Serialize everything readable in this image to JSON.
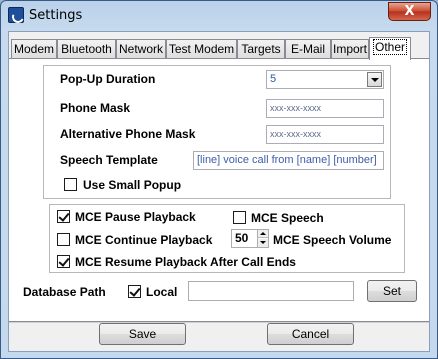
{
  "window": {
    "title": "Settings",
    "close_label": "X"
  },
  "tabs": [
    {
      "label": "Modem"
    },
    {
      "label": "Bluetooth"
    },
    {
      "label": "Network"
    },
    {
      "label": "Test Modem"
    },
    {
      "label": "Targets"
    },
    {
      "label": "E-Mail"
    },
    {
      "label": "Import"
    },
    {
      "label": "Other",
      "active": true
    }
  ],
  "popup": {
    "duration_label": "Pop-Up Duration",
    "duration_value": "5",
    "phone_mask_label": "Phone Mask",
    "phone_mask_value": "xxx-xxx-xxxx",
    "alt_phone_mask_label": "Alternative Phone Mask",
    "alt_phone_mask_value": "xxx-xxx-xxxx",
    "speech_template_label": "Speech Template",
    "speech_template_value": "[line] voice call from [name] [number]",
    "use_small_popup_label": "Use Small Popup",
    "use_small_popup_checked": false
  },
  "mce": {
    "pause_playback_label": "MCE Pause Playback",
    "pause_playback_checked": true,
    "speech_label": "MCE Speech",
    "speech_checked": false,
    "continue_playback_label": "MCE Continue Playback",
    "continue_playback_checked": false,
    "speech_volume_value": "50",
    "speech_volume_label": "MCE Speech Volume",
    "resume_playback_label": "MCE Resume Playback After Call Ends",
    "resume_playback_checked": true
  },
  "database": {
    "path_label": "Database Path",
    "local_label": "Local",
    "local_checked": true,
    "path_value": "",
    "set_label": "Set"
  },
  "footer": {
    "save_label": "Save",
    "cancel_label": "Cancel"
  }
}
